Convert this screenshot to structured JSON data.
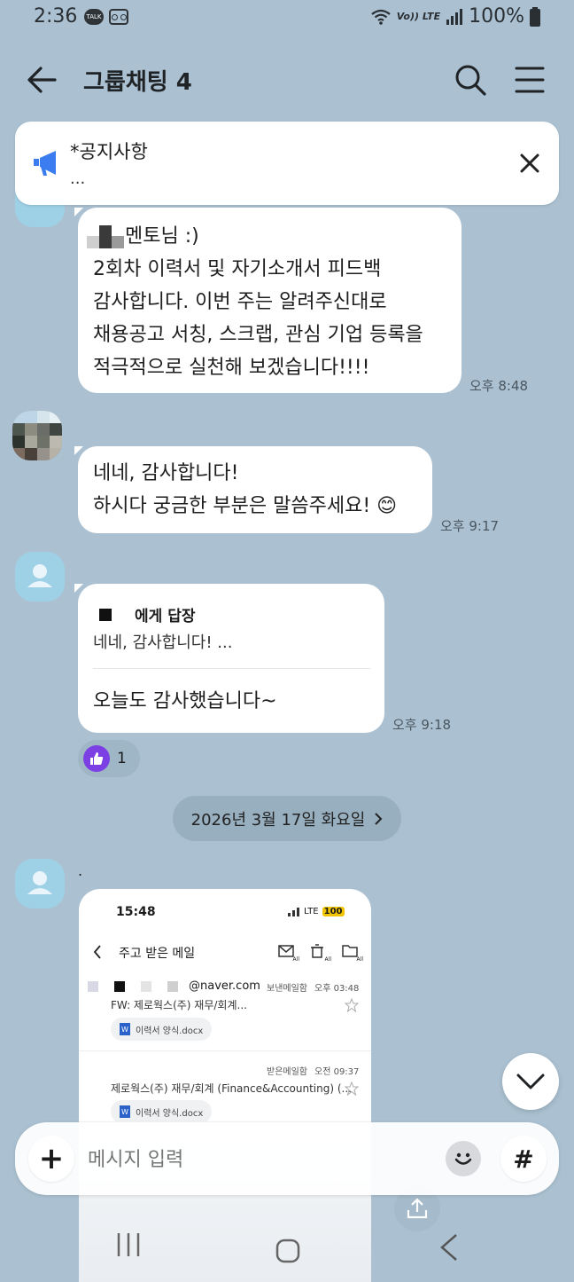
{
  "status_bar": {
    "time": "2:36",
    "talk_badge": "TALK",
    "network": "Vo)) LTE",
    "battery": "100%"
  },
  "header": {
    "title": "그룹채팅 4"
  },
  "notice": {
    "title": "*공지사항",
    "preview": "..."
  },
  "messages": [
    {
      "lines": [
        "멘토님 :)",
        "2회차 이력서 및 자기소개서 피드백",
        "감사합니다. 이번 주는 알려주신대로",
        "채용공고 서칭, 스크랩, 관심 기업 등록을",
        "적극적으로 실천해 보겠습니다!!!!"
      ],
      "time": "오후 8:48"
    },
    {
      "lines": [
        "네네, 감사합니다!",
        "하시다 궁금한 부분은 말씀주세요!"
      ],
      "emoji": "😊",
      "time": "오후 9:17"
    },
    {
      "reply_to": "에게 답장",
      "reply_preview": "네네, 감사합니다! ...",
      "text": "오늘도 감사했습니다~",
      "time": "오후 9:18",
      "reaction_count": "1"
    }
  ],
  "date_divider": "2026년 3월 17일 화요일",
  "sender_dot": ".",
  "screenshot": {
    "time": "15:48",
    "network": "LTE",
    "battery": "100",
    "title": "주고 받은 메일",
    "mail1": {
      "from": "@naver.com",
      "folder": "보낸메일함",
      "time": "오후 03:48",
      "subject": "FW: 제로웍스(주) 재무/회계...",
      "attachment": "이력서 양식.docx"
    },
    "mail2": {
      "folder": "받은메일함",
      "time": "오전 09:37",
      "subject": "제로웍스(주) 재무/회계 (Finance&Accounting) (...",
      "attachment": "이력서 양식.docx"
    },
    "toolbar_labels": [
      "All",
      "All",
      "All"
    ]
  },
  "composer": {
    "placeholder": "메시지 입력",
    "hash_label": "#",
    "plus_label": "+"
  },
  "colors": {
    "chat_bg": "#abc1d1",
    "reaction_purple": "#7b3fe4",
    "notice_icon_blue": "#3b7cf0"
  }
}
